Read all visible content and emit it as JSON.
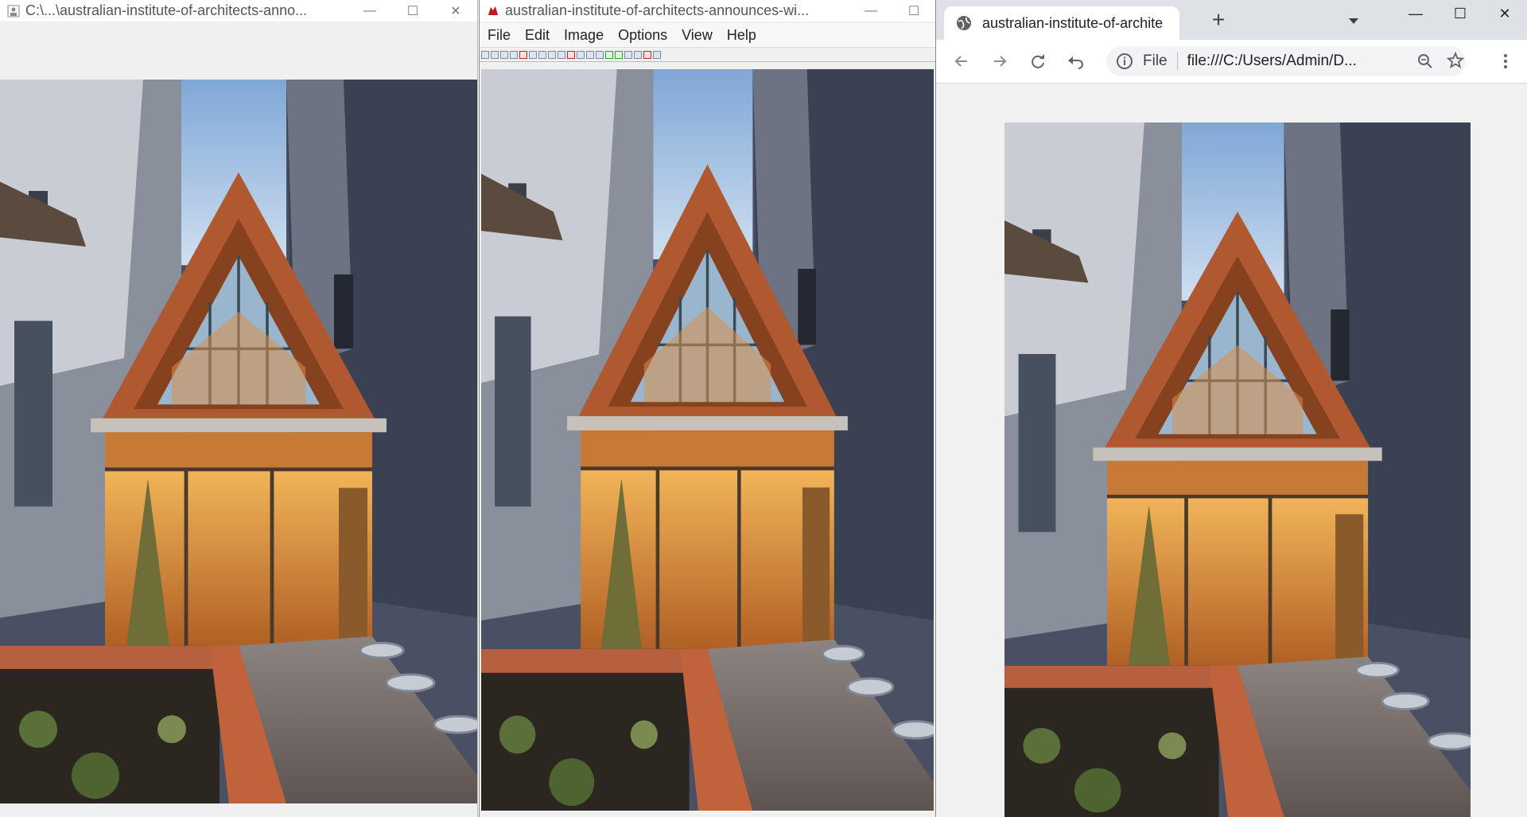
{
  "windows": {
    "viewer1": {
      "title": "C:\\...\\australian-institute-of-architects-anno...",
      "icon": "image-viewer-icon",
      "controls": {
        "minimize": "—",
        "maximize": "☐",
        "close": "✕"
      }
    },
    "irfanview": {
      "title": "australian-institute-of-architects-announces-wi...",
      "icon": "irfanview-cat-icon",
      "menu": [
        "File",
        "Edit",
        "Image",
        "Options",
        "View",
        "Help"
      ],
      "controls": {
        "minimize": "—",
        "maximize": "☐"
      }
    },
    "chrome": {
      "tab_title": "australian-institute-of-archite",
      "new_tab": "+",
      "scheme_label": "File",
      "url": "file:///C:/Users/Admin/D...",
      "controls": {
        "minimize": "—",
        "maximize": "☐",
        "close": "✕"
      }
    }
  },
  "image_subject": "courtyard-bar-a-frame-building",
  "colors": {
    "sky": "#9fc2e8",
    "timber": "#b0582f",
    "brick_dark": "#3a4152",
    "warm_light": "#e8a24a",
    "chrome_tabstrip": "#dee1e6"
  }
}
